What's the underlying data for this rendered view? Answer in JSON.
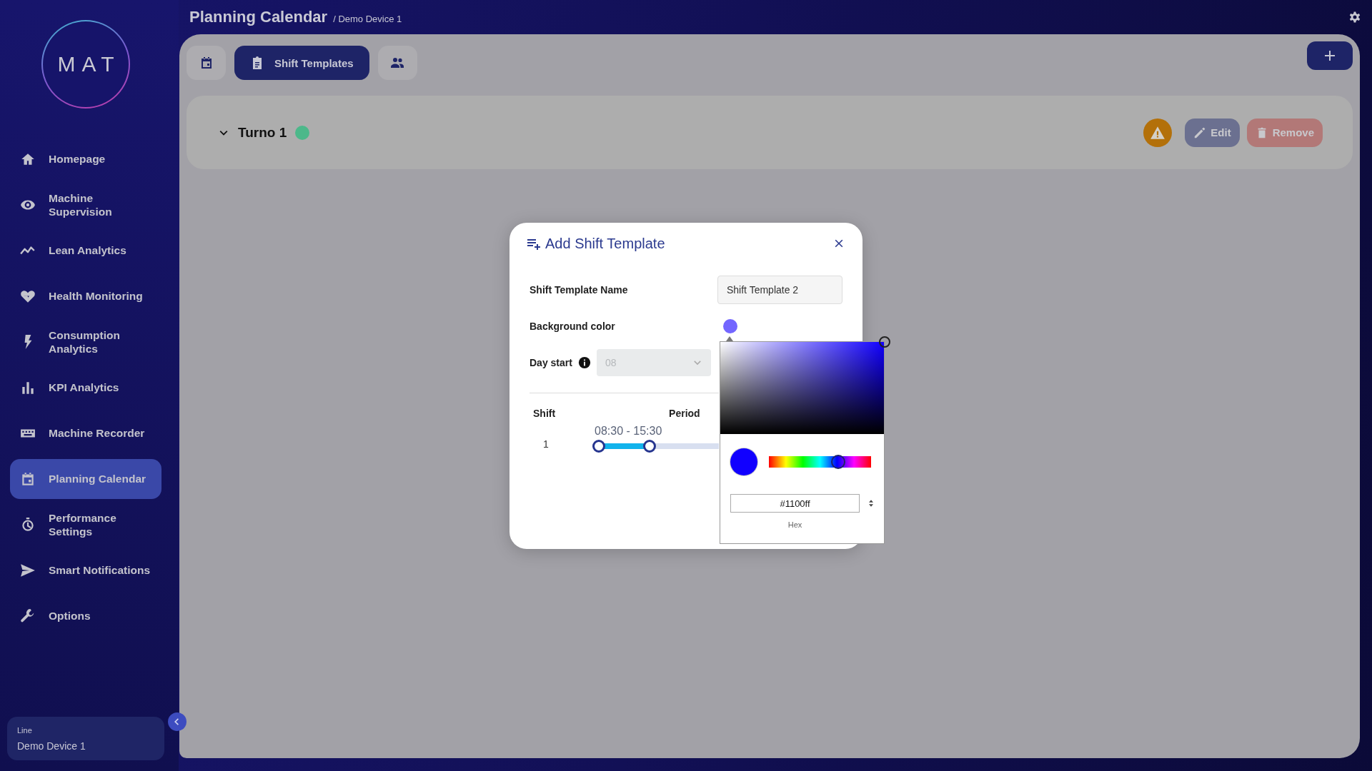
{
  "sidebar": {
    "logo": "MAT",
    "items": [
      {
        "kind": "home",
        "label": "Homepage",
        "selected": false
      },
      {
        "kind": "eye",
        "label": "Machine Supervision",
        "selected": false
      },
      {
        "kind": "trend",
        "label": "Lean Analytics",
        "selected": false
      },
      {
        "kind": "heart",
        "label": "Health Monitoring",
        "selected": false
      },
      {
        "kind": "bolt",
        "label": "Consumption Analytics",
        "selected": false
      },
      {
        "kind": "bars",
        "label": "KPI Analytics",
        "selected": false
      },
      {
        "kind": "recorder",
        "label": "Machine Recorder",
        "selected": false
      },
      {
        "kind": "calendar",
        "label": "Planning Calendar",
        "selected": true
      },
      {
        "kind": "stopwatch",
        "label": "Performance Settings",
        "selected": false
      },
      {
        "kind": "send",
        "label": "Smart Notifications",
        "selected": false
      },
      {
        "kind": "wrench",
        "label": "Options",
        "selected": false
      }
    ],
    "footer": {
      "label": "Line",
      "value": "Demo Device 1"
    }
  },
  "header": {
    "title": "Planning Calendar",
    "breadcrumb": "/ Demo Device 1"
  },
  "tabs": [
    {
      "kind": "calendar",
      "selected": false
    },
    {
      "kind": "clipboard",
      "label": "Shift Templates",
      "selected": true
    },
    {
      "kind": "people",
      "selected": false
    }
  ],
  "templates": [
    {
      "name": "Turno 1",
      "color": "#4cb88a",
      "warning": true,
      "actions": [
        {
          "kind": "edit",
          "label": "Edit"
        },
        {
          "kind": "remove",
          "label": "Remove"
        }
      ]
    }
  ],
  "dialog": {
    "title": "Add Shift Template",
    "name_label": "Shift Template Name",
    "name_value": "Shift Template 2",
    "color_label": "Background color",
    "color": "#7366ff",
    "day_start_label": "Day start",
    "day_start_value": "08",
    "columns": [
      "Shift",
      "Period"
    ],
    "rows": [
      {
        "shift": "1",
        "period": "08:30 - 15:30",
        "level": 0.42
      }
    ]
  },
  "picker": {
    "hex": "#1100ff",
    "hex_label": "Hex",
    "hue": {
      "level": 0.68
    }
  }
}
